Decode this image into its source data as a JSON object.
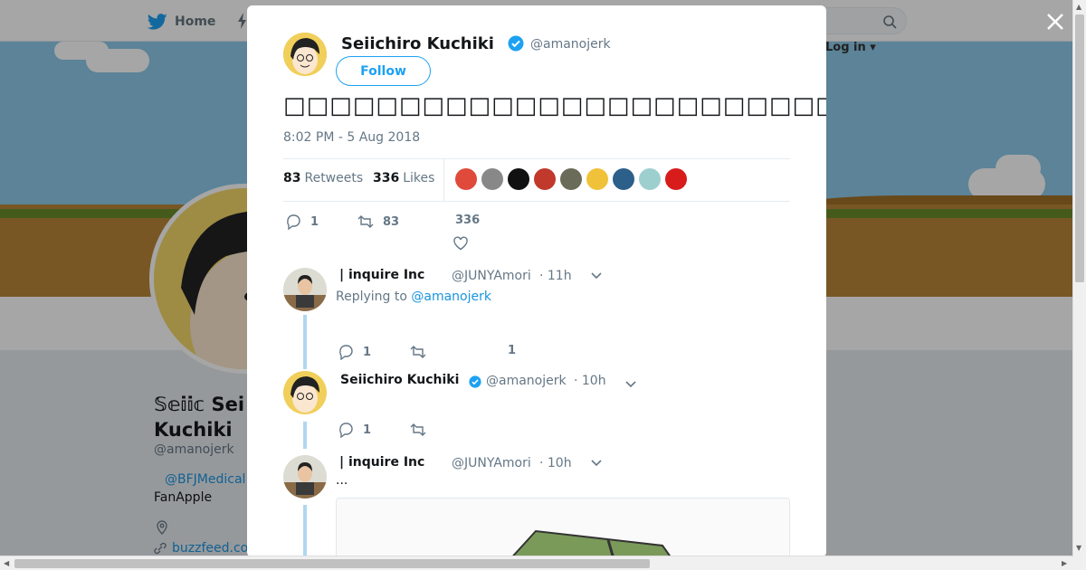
{
  "background": {
    "nav": {
      "home_label": "Home",
      "login_label": "Log in ▾"
    },
    "profile": {
      "name": "𝕊𝕖𝕚𝕚𝕔𝕙𝕚 Sei Kuchiki",
      "name_line1": "𝕊𝕖𝕚𝕚𝕔 Sei",
      "name_line2": "Kuchiki",
      "handle": "@amanojerk",
      "bio_link": "@BFJMedical",
      "bio_text": "FanApple",
      "url": "buzzfeed.co"
    }
  },
  "tweet": {
    "author_name": "Seiichiro Kuchiki",
    "author_handle": "@amanojerk",
    "follow_label": "Follow",
    "text": "□□□□□□□□□□□□□□□□□□□□□□□□□□□□□□□□□□□□□□□□□□□□□□□□□□□□□□□",
    "timestamp": "8:02 PM - 5 Aug 2018",
    "retweets_count": "83",
    "retweets_label": "Retweets",
    "likes_count": "336",
    "likes_label": "Likes",
    "likers_colors": [
      "#e04a3a",
      "#888888",
      "#111111",
      "#c0392b",
      "#6b6b5a",
      "#f0c23a",
      "#2c5f8a",
      "#9ecfcf",
      "#d81b1b"
    ],
    "action_reply_count": "1",
    "action_retweet_count": "83",
    "action_like_count": "336"
  },
  "replies": [
    {
      "name": "| inquire Inc",
      "handle": "@JUNYAmori",
      "time": "· 11h",
      "replying_prefix": "Replying to",
      "replying_to": "@amanojerk",
      "reply_count": "1",
      "like_count": "1"
    },
    {
      "name": "Seiichiro Kuchiki",
      "handle": "@amanojerk",
      "time": "· 10h",
      "reply_count": "1"
    },
    {
      "name": "| inquire Inc",
      "handle": "@JUNYAmori",
      "time": "· 10h",
      "text": "..."
    }
  ],
  "colors": {
    "accent": "#1da1f2",
    "verified": "#1da1f2",
    "thread_line": "#aed8ee"
  }
}
